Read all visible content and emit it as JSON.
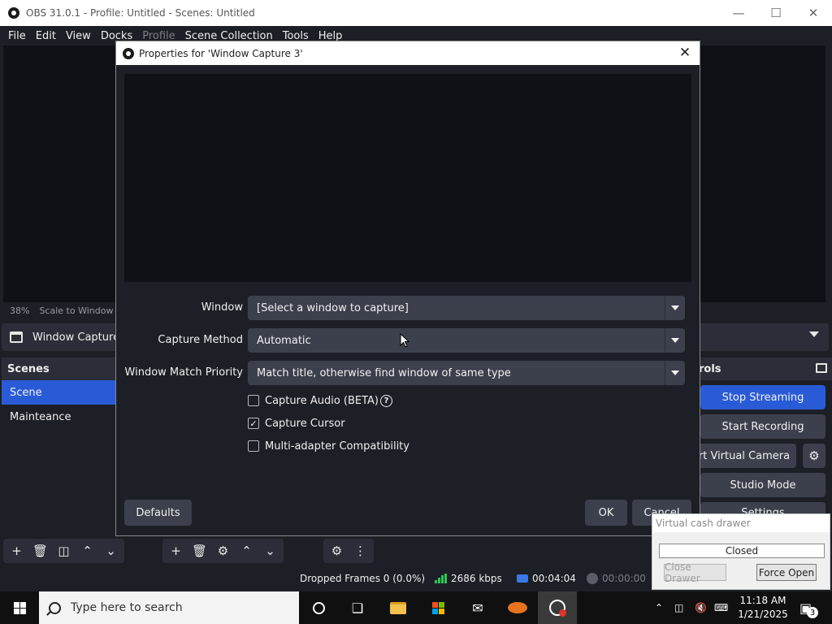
{
  "window": {
    "title": "OBS 31.0.1 - Profile: Untitled - Scenes: Untitled"
  },
  "menu": {
    "items": [
      "File",
      "Edit",
      "View",
      "Docks",
      "Profile",
      "Scene Collection",
      "Tools",
      "Help"
    ],
    "disabled": [
      "Profile"
    ]
  },
  "preview": {
    "zoom": "38%",
    "scale_mode": "Scale to Window"
  },
  "source_bar": {
    "label": "Window Capture"
  },
  "scenes": {
    "header": "Scenes",
    "items": [
      "Scene",
      "Mainteance"
    ],
    "selected": "Scene"
  },
  "controls": {
    "header": "rols",
    "stop_streaming": "Stop Streaming",
    "start_recording": "Start Recording",
    "virtual_camera": "rt Virtual Camera",
    "studio_mode": "Studio Mode",
    "settings": "Settings"
  },
  "status": {
    "dropped_frames": "Dropped Frames 0 (0.0%)",
    "bitrate": "2686 kbps",
    "stream_time": "00:04:04",
    "record_time": "00:00:00"
  },
  "dialog": {
    "title": "Properties for 'Window Capture 3'",
    "fields": {
      "window": {
        "label": "Window",
        "value": "[Select a window to capture]"
      },
      "capture_method": {
        "label": "Capture Method",
        "value": "Automatic"
      },
      "match_priority": {
        "label": "Window Match Priority",
        "value": "Match title, otherwise find window of same type"
      }
    },
    "checkboxes": {
      "capture_audio": {
        "label": "Capture Audio (BETA)",
        "checked": false
      },
      "capture_cursor": {
        "label": "Capture Cursor",
        "checked": true
      },
      "multi_adapter": {
        "label": "Multi-adapter Compatibility",
        "checked": false
      }
    },
    "buttons": {
      "defaults": "Defaults",
      "ok": "OK",
      "cancel": "Cancel"
    }
  },
  "cash_drawer": {
    "title": "Virtual cash drawer",
    "state": "Closed",
    "close_button": "Close Drawer",
    "open_button": "Force Open"
  },
  "taskbar": {
    "search_placeholder": "Type here to search",
    "time": "11:18 AM",
    "date": "1/21/2025",
    "notification_count": "3"
  },
  "colors": {
    "accent": "#2a5bd7",
    "panel": "#1d1f26",
    "control": "#3c404d",
    "signal": "#2ec654"
  }
}
